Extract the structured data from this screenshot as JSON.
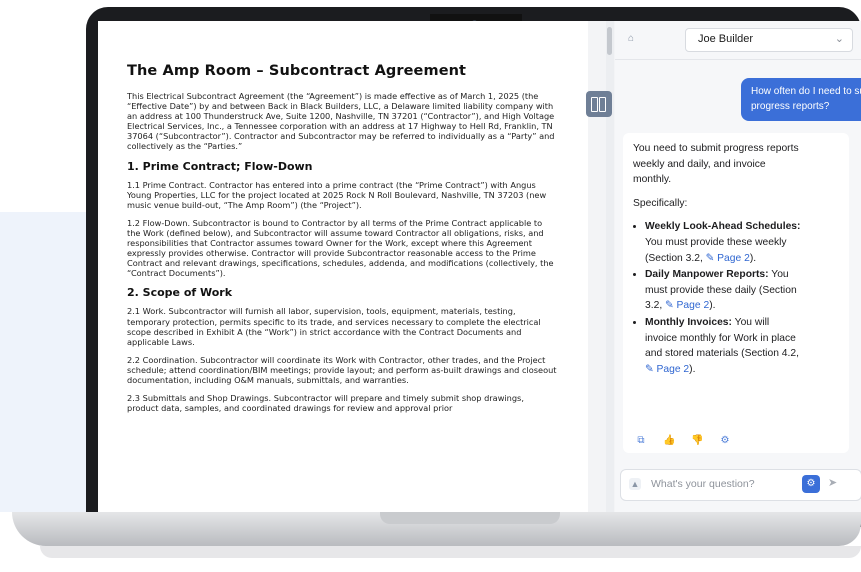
{
  "document": {
    "title": "The Amp Room – Subcontract Agreement",
    "intro": "This Electrical Subcontract Agreement (the “Agreement”) is made effective as of March 1, 2025 (the “Effective Date”) by and between Back in Black Builders, LLC, a Delaware limited liability company with an address at 100 Thunderstruck Ave, Suite 1200, Nashville, TN 37201 (“Contractor”), and High Voltage Electrical Services, Inc., a Tennessee corporation with an address at 17 Highway to Hell Rd, Franklin, TN 37064 (“Subcontractor”). Contractor and Subcontractor may be referred to individually as a “Party” and collectively as the “Parties.”",
    "section1_heading": "1. Prime Contract; Flow-Down",
    "s1_1": "1.1 Prime Contract. Contractor has entered into a prime contract (the “Prime Contract”) with Angus Young Properties, LLC for the project located at 2025 Rock N Roll Boulevard, Nashville, TN 37203 (new music venue build-out, “The Amp Room”) (the “Project”).",
    "s1_2": "1.2 Flow-Down. Subcontractor is bound to Contractor by all terms of the Prime Contract applicable to the Work (defined below), and Subcontractor will assume toward Contractor all obligations, risks, and responsibilities that Contractor assumes toward Owner for the Work, except where this Agreement expressly provides otherwise. Contractor will provide Subcontractor reasonable access to the Prime Contract and relevant drawings, specifications, schedules, addenda, and modifications (collectively, the “Contract Documents”).",
    "section2_heading": "2. Scope of Work",
    "s2_1": "2.1 Work. Subcontractor will furnish all labor, supervision, tools, equipment, materials, testing, temporary protection, permits specific to its trade, and services necessary to complete the electrical scope described in Exhibit A (the “Work”) in strict accordance with the Contract Documents and applicable Laws.",
    "s2_2": "2.2 Coordination. Subcontractor will coordinate its Work with Contractor, other trades, and the Project schedule; attend coordination/BIM meetings; provide layout; and perform as-built drawings and closeout documentation, including O&M manuals, submittals, and warranties.",
    "s2_3": "2.3 Submittals and Shop Drawings. Subcontractor will prepare and timely submit shop drawings, product data, samples, and coordinated drawings for review and approval prior"
  },
  "chat": {
    "user_name": "Joe Builder",
    "user_message": "How often do I need to submit progress reports?",
    "answer_intro": "You need to submit progress reports weekly and daily, and invoice monthly.",
    "answer_specifically": "Specifically:",
    "items": [
      {
        "title": "Weekly Look-Ahead Schedules:",
        "text": " You must provide these weekly (Section 3.2, ",
        "link": "Page 2",
        "tail": ")."
      },
      {
        "title": "Daily Manpower Reports:",
        "text": " You must provide these daily (Section 3.2, ",
        "link": "Page 2",
        "tail": ")."
      },
      {
        "title": "Monthly Invoices:",
        "text": " You will invoice monthly for Work in place and stored materials (Section 4.2, ",
        "link": "Page 2",
        "tail": ")."
      }
    ],
    "input_placeholder": "What's your question?"
  },
  "icons": {
    "home": "home-icon",
    "chevron": "chevron-down-icon",
    "split": "split-view-icon",
    "copy": "copy-icon",
    "thumbs_up": "thumbs-up-icon",
    "thumbs_down": "thumbs-down-icon",
    "settings": "gear-icon",
    "send": "send-icon"
  },
  "colors": {
    "accent": "#3b6fd8",
    "link": "#2f66d1",
    "bezel": "#1b1c1f"
  }
}
